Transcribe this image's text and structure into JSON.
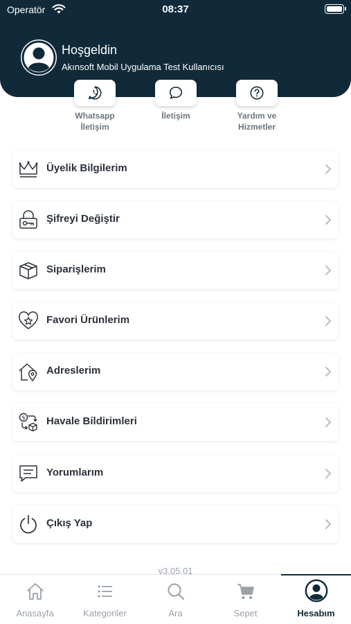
{
  "status_bar": {
    "carrier": "Operatör",
    "time": "08:37"
  },
  "header": {
    "title": "Hoşgeldin",
    "subtitle": "Akınsoft Mobil Uygulama Test Kullanıcısı"
  },
  "quick_actions": [
    {
      "label": "Whatsapp\nİletişim",
      "icon": "whatsapp-icon"
    },
    {
      "label": "İletişim",
      "icon": "chat-bubble-icon"
    },
    {
      "label": "Yardım ve\nHizmetler",
      "icon": "help-icon"
    }
  ],
  "menu": [
    {
      "label": "Üyelik Bilgilerim",
      "icon": "crown-icon"
    },
    {
      "label": "Şifreyi Değiştir",
      "icon": "lock-key-icon"
    },
    {
      "label": "Siparişlerim",
      "icon": "package-box-icon"
    },
    {
      "label": "Favori Ürünlerim",
      "icon": "heart-star-icon"
    },
    {
      "label": "Adreslerim",
      "icon": "home-location-icon"
    },
    {
      "label": "Havale Bildirimleri",
      "icon": "money-transfer-icon"
    },
    {
      "label": "Yorumlarım",
      "icon": "comment-icon"
    },
    {
      "label": "Çıkış Yap",
      "icon": "power-icon"
    }
  ],
  "version": "v3.05.01",
  "tabs": [
    {
      "label": "Anasayfa",
      "icon": "home-icon",
      "active": false
    },
    {
      "label": "Kategoriler",
      "icon": "list-icon",
      "active": false
    },
    {
      "label": "Ara",
      "icon": "search-icon",
      "active": false
    },
    {
      "label": "Sepet",
      "icon": "cart-icon",
      "active": false
    },
    {
      "label": "Hesabım",
      "icon": "account-icon",
      "active": true
    }
  ],
  "colors": {
    "header_bg": "#102a3a",
    "active_tab": "#102a3a",
    "inactive_tab": "#9aa1a8"
  }
}
